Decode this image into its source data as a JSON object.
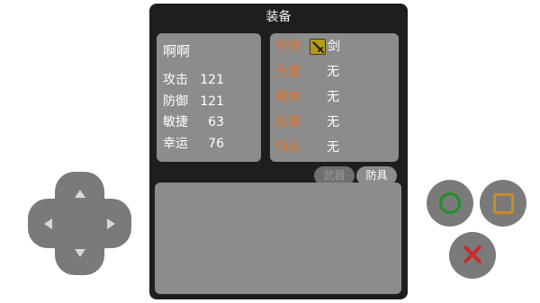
{
  "dialog": {
    "title": "装备"
  },
  "character": {
    "name": "啊啊",
    "stats": [
      {
        "label": "攻击",
        "value": "121"
      },
      {
        "label": "防御",
        "value": "121"
      },
      {
        "label": "敏捷",
        "value": "63"
      },
      {
        "label": "幸运",
        "value": "76"
      }
    ]
  },
  "equipment": {
    "slots": [
      {
        "label": "手持",
        "value": "剑",
        "icon": "sword-icon"
      },
      {
        "label": "头部",
        "value": "无"
      },
      {
        "label": "身体",
        "value": "无"
      },
      {
        "label": "足部",
        "value": "无"
      },
      {
        "label": "饰品",
        "value": "无"
      }
    ]
  },
  "tabs": {
    "weapon": "武器",
    "armor": "防具",
    "selected": "防具"
  },
  "controls": {
    "dpad": "dpad",
    "buttons": [
      "circle-button",
      "square-button",
      "cross-button"
    ]
  },
  "colors": {
    "dialog_bg": "#1e1e1e",
    "panel_bg": "#8c8c8c",
    "slot_label": "#e7742a",
    "circle": "#1f8f2a",
    "square": "#c88a2a",
    "cross": "#c62b2b"
  }
}
